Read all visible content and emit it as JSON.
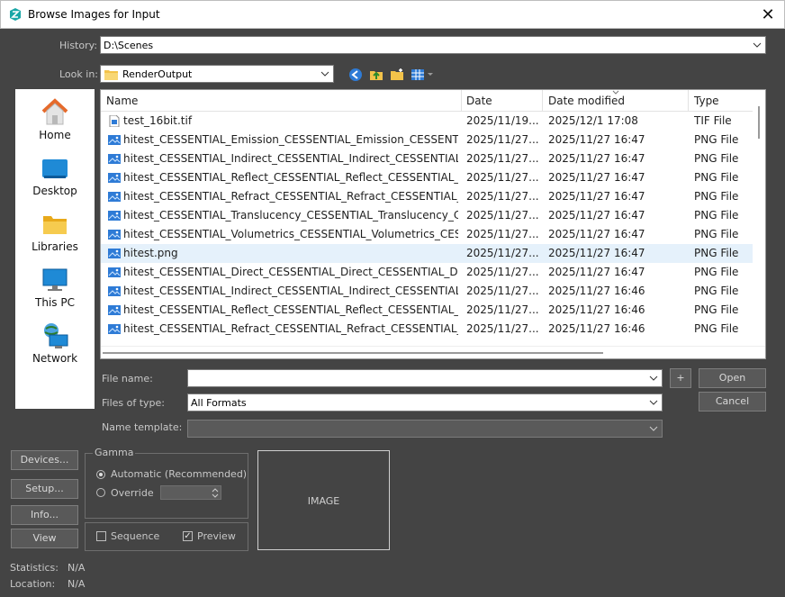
{
  "window": {
    "title": "Browse Images for Input",
    "close_glyph": "✕"
  },
  "history": {
    "label": "History:",
    "value": "D:\\Scenes"
  },
  "lookin": {
    "label": "Look in:",
    "value": "RenderOutput"
  },
  "places": [
    {
      "label": "Home",
      "icon": "home-icon"
    },
    {
      "label": "Desktop",
      "icon": "desktop-icon"
    },
    {
      "label": "Libraries",
      "icon": "libraries-icon"
    },
    {
      "label": "This PC",
      "icon": "this-pc-icon"
    },
    {
      "label": "Network",
      "icon": "network-icon"
    }
  ],
  "columns": [
    "Name",
    "Date",
    "Date modified",
    "Type"
  ],
  "files": [
    {
      "name": "test_16bit.tif",
      "date": "2025/11/19...",
      "modified": "2025/12/1 17:08",
      "type": "TIF File",
      "kind": "tif",
      "selected": false
    },
    {
      "name": "hitest_CESSENTIAL_Emission_CESSENTIAL_Emission_CESSENTI...",
      "date": "2025/11/27...",
      "modified": "2025/11/27 16:47",
      "type": "PNG File",
      "kind": "png",
      "selected": false
    },
    {
      "name": "hitest_CESSENTIAL_Indirect_CESSENTIAL_Indirect_CESSENTIAL_...",
      "date": "2025/11/27...",
      "modified": "2025/11/27 16:47",
      "type": "PNG File",
      "kind": "png",
      "selected": false
    },
    {
      "name": "hitest_CESSENTIAL_Reflect_CESSENTIAL_Reflect_CESSENTIAL_R...",
      "date": "2025/11/27...",
      "modified": "2025/11/27 16:47",
      "type": "PNG File",
      "kind": "png",
      "selected": false
    },
    {
      "name": "hitest_CESSENTIAL_Refract_CESSENTIAL_Refract_CESSENTIAL_...",
      "date": "2025/11/27...",
      "modified": "2025/11/27 16:47",
      "type": "PNG File",
      "kind": "png",
      "selected": false
    },
    {
      "name": "hitest_CESSENTIAL_Translucency_CESSENTIAL_Translucency_CE...",
      "date": "2025/11/27...",
      "modified": "2025/11/27 16:47",
      "type": "PNG File",
      "kind": "png",
      "selected": false
    },
    {
      "name": "hitest_CESSENTIAL_Volumetrics_CESSENTIAL_Volumetrics_CES...",
      "date": "2025/11/27...",
      "modified": "2025/11/27 16:47",
      "type": "PNG File",
      "kind": "png",
      "selected": false
    },
    {
      "name": "hitest.png",
      "date": "2025/11/27...",
      "modified": "2025/11/27 16:47",
      "type": "PNG File",
      "kind": "png",
      "selected": true
    },
    {
      "name": "hitest_CESSENTIAL_Direct_CESSENTIAL_Direct_CESSENTIAL_Dir...",
      "date": "2025/11/27...",
      "modified": "2025/11/27 16:47",
      "type": "PNG File",
      "kind": "png",
      "selected": false
    },
    {
      "name": "hitest_CESSENTIAL_Indirect_CESSENTIAL_Indirect_CESSENTIAL_...",
      "date": "2025/11/27...",
      "modified": "2025/11/27 16:46",
      "type": "PNG File",
      "kind": "png",
      "selected": false
    },
    {
      "name": "hitest_CESSENTIAL_Reflect_CESSENTIAL_Reflect_CESSENTIAL_R...",
      "date": "2025/11/27...",
      "modified": "2025/11/27 16:46",
      "type": "PNG File",
      "kind": "png",
      "selected": false
    },
    {
      "name": "hitest_CESSENTIAL_Refract_CESSENTIAL_Refract_CESSENTIAL_...",
      "date": "2025/11/27...",
      "modified": "2025/11/27 16:46",
      "type": "PNG File",
      "kind": "png",
      "selected": false
    }
  ],
  "form": {
    "filename_label": "File name:",
    "filename_value": "",
    "plus_label": "+",
    "filetype_label": "Files of type:",
    "filetype_value": "All Formats",
    "template_label": "Name template:",
    "template_value": "",
    "open_label": "Open",
    "cancel_label": "Cancel"
  },
  "side_buttons": {
    "devices": "Devices...",
    "setup": "Setup...",
    "info": "Info...",
    "view": "View"
  },
  "gamma": {
    "title": "Gamma",
    "automatic": "Automatic (Recommended)",
    "override": "Override",
    "automatic_selected": true,
    "override_value": ""
  },
  "options": {
    "sequence": "Sequence",
    "preview": "Preview",
    "sequence_checked": false,
    "preview_checked": true
  },
  "preview_text": "IMAGE",
  "stats": {
    "statistics_label": "Statistics:",
    "statistics_value": "N/A",
    "location_label": "Location:",
    "location_value": "N/A"
  },
  "colors": {
    "background": "#444444",
    "selection": "#e5f1fb",
    "folder": "#f3c34a",
    "accent": "#2e7bd6"
  }
}
